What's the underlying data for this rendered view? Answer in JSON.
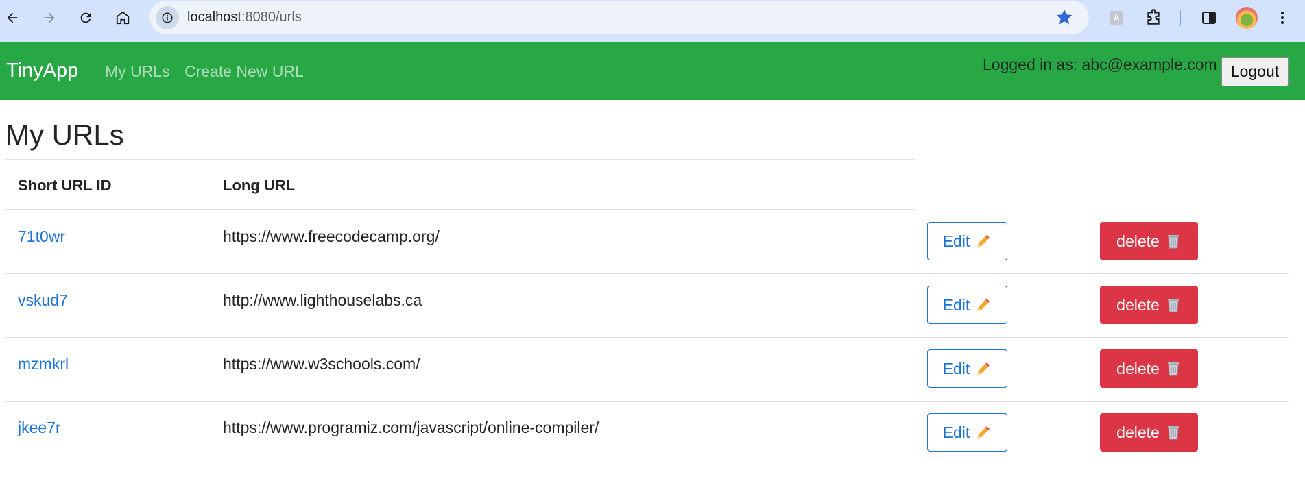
{
  "browser": {
    "url_host": "localhost",
    "url_path": ":8080/urls",
    "icons": [
      "back-arrow-icon",
      "forward-arrow-icon",
      "reload-icon",
      "home-icon",
      "site-info-icon",
      "bookmark-star-icon",
      "extension-icon",
      "puzzle-icon",
      "side-panel-icon",
      "profile-avatar",
      "kebab-menu-icon"
    ],
    "star_color": "#3367d6"
  },
  "navbar": {
    "brand": "TinyApp",
    "links": [
      "My URLs",
      "Create New URL"
    ],
    "logged_in_text": "Logged in as: abc@example.com",
    "logout_label": "Logout",
    "color": "#28a745"
  },
  "main": {
    "title": "My URLs",
    "headers": {
      "short_id": "Short URL ID",
      "long_url": "Long URL"
    },
    "edit_label": "Edit",
    "delete_label": "delete",
    "rows": [
      {
        "id": "71t0wr",
        "long": "https://www.freecodecamp.org/"
      },
      {
        "id": "vskud7",
        "long": "http://www.lighthouselabs.ca"
      },
      {
        "id": "mzmkrl",
        "long": "https://www.w3schools.com/"
      },
      {
        "id": "jkee7r",
        "long": "https://www.programiz.com/javascript/online-compiler/"
      }
    ]
  }
}
